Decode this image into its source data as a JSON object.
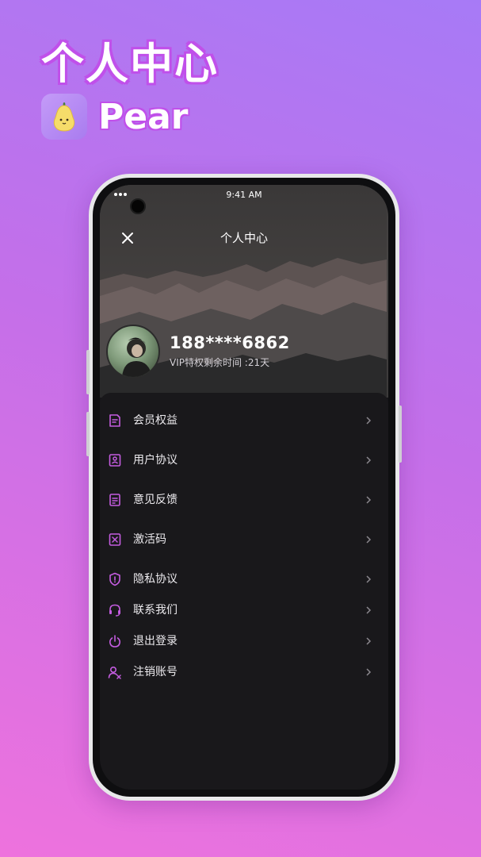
{
  "promo": {
    "title": "个人中心",
    "app_name": "Pear",
    "app_icon": "pear-icon"
  },
  "status_bar": {
    "time": "9:41 AM"
  },
  "header": {
    "title": "个人中心",
    "close_icon": "close-icon"
  },
  "profile": {
    "phone": "188****6862",
    "vip_text": "VIP特权剩余时间 :21天"
  },
  "menu": {
    "items": [
      {
        "label": "会员权益",
        "icon": "document-icon"
      },
      {
        "label": "用户协议",
        "icon": "bookmark-user-icon"
      },
      {
        "label": "意见反馈",
        "icon": "feedback-icon"
      },
      {
        "label": "激活码",
        "icon": "activation-code-icon"
      },
      {
        "label": "隐私协议",
        "icon": "shield-icon"
      },
      {
        "label": "联系我们",
        "icon": "headset-icon"
      },
      {
        "label": "退出登录",
        "icon": "power-icon"
      },
      {
        "label": "注销账号",
        "icon": "user-remove-icon"
      }
    ]
  },
  "colors": {
    "accent": "#c45ce0",
    "background_top": "#a77af6",
    "background_bottom": "#ee72dd",
    "menu_background": "#19181b"
  }
}
